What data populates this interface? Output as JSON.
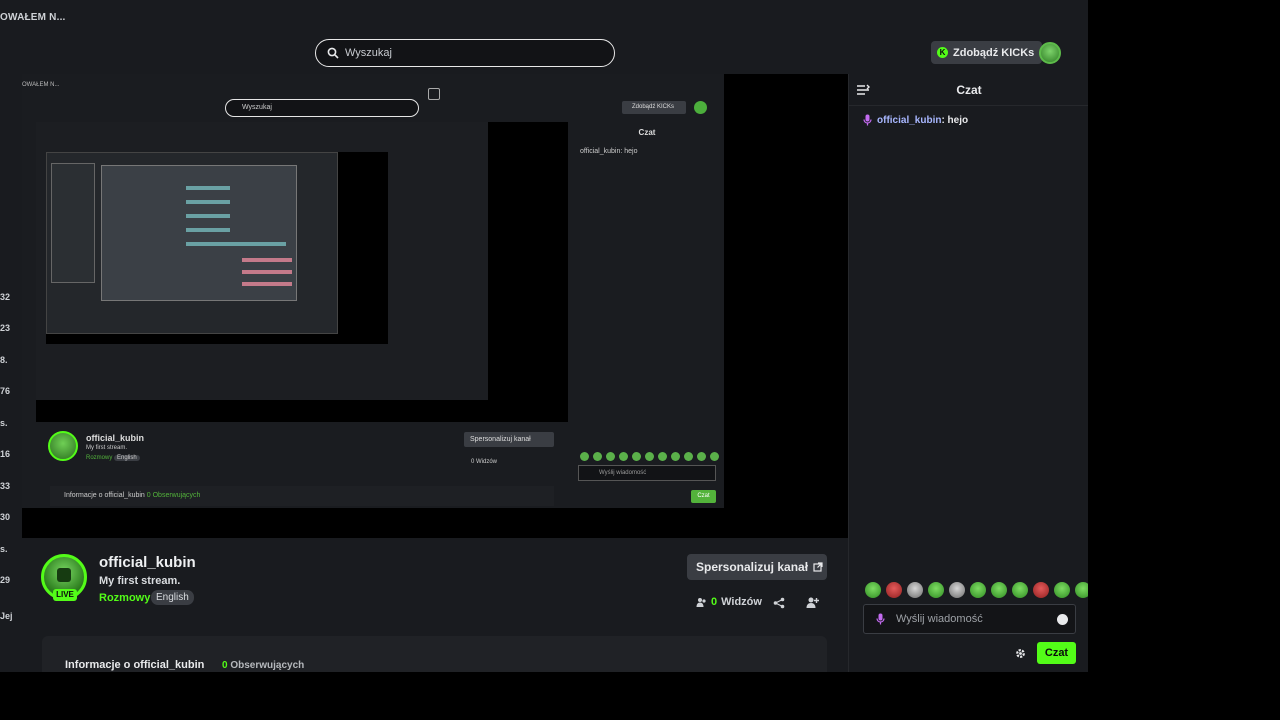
{
  "topbar": {
    "breadcrumb": "OWAŁEM N...",
    "search": {
      "placeholder": "Wyszukaj"
    },
    "kicks_button": "Zdobądź KICKs"
  },
  "left_numbers": [
    "32",
    "23",
    "8.",
    "76",
    "s.",
    "16",
    "33",
    "30",
    "s.",
    "29",
    "Jej"
  ],
  "player_capture": {
    "breadcrumb": "OWAŁEM N...",
    "search_text": "Wyszukaj",
    "kicks_button": "Zdobądź KICKs",
    "chat_title": "Czat",
    "chat_message": "official_kubin: hejo",
    "channel_name": "official_kubin",
    "stream_title": "My first stream.",
    "category": "Rozmowy",
    "language": "English",
    "personalize": "Spersonalizuj kanał",
    "viewers": "0 Widzów",
    "input_placeholder": "Wyślij wiadomość",
    "send": "Czat",
    "about": "Informacje o official_kubin",
    "followers": "0 Obserwujących"
  },
  "channel": {
    "name": "official_kubin",
    "title": "My first stream.",
    "category": "Rozmowy",
    "language": "English",
    "live_badge": "LIVE",
    "personalize_button": "Spersonalizuj kanał",
    "viewers_count": "0",
    "viewers_label": "Widzów"
  },
  "about": {
    "title": "Informacje o official_kubin",
    "followers_count": "0",
    "followers_label": "Obserwujących"
  },
  "chat": {
    "title": "Czat",
    "messages": [
      {
        "user": "official_kubin",
        "text": ": hejo"
      }
    ],
    "input_placeholder": "Wyślij wiadomość",
    "send_button": "Czat",
    "emotes": [
      "emote-1",
      "emote-2-red",
      "emote-3-grey",
      "emote-4",
      "emote-5-grey",
      "emote-6",
      "emote-7",
      "emote-8",
      "emote-9-red",
      "emote-10",
      "emote-11"
    ]
  },
  "colors": {
    "accent": "#53fc18",
    "background": "#191b1f",
    "button": "#3a3d43"
  }
}
